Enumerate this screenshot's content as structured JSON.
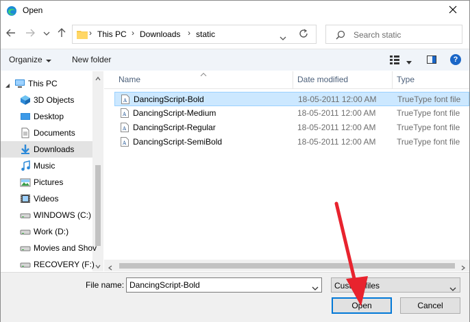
{
  "window": {
    "title": "Open",
    "icon": "edge-icon"
  },
  "nav": {
    "breadcrumbs": [
      "This PC",
      "Downloads",
      "static"
    ],
    "search_placeholder": "Search static"
  },
  "toolbar": {
    "organize_label": "Organize",
    "new_folder_label": "New folder",
    "help_label": "?"
  },
  "sidebar": {
    "items": [
      {
        "label": "This PC",
        "icon": "computer-icon"
      },
      {
        "label": "3D Objects",
        "icon": "3d-objects-icon"
      },
      {
        "label": "Desktop",
        "icon": "desktop-icon"
      },
      {
        "label": "Documents",
        "icon": "documents-icon"
      },
      {
        "label": "Downloads",
        "icon": "downloads-icon",
        "selected": true
      },
      {
        "label": "Music",
        "icon": "music-icon"
      },
      {
        "label": "Pictures",
        "icon": "pictures-icon"
      },
      {
        "label": "Videos",
        "icon": "videos-icon"
      },
      {
        "label": "WINDOWS (C:)",
        "icon": "drive-icon"
      },
      {
        "label": "Work (D:)",
        "icon": "drive-icon"
      },
      {
        "label": "Movies and Shov",
        "icon": "drive-icon"
      },
      {
        "label": "RECOVERY (F:)",
        "icon": "drive-icon"
      }
    ]
  },
  "files": {
    "columns": [
      "Name",
      "Date modified",
      "Type"
    ],
    "rows": [
      {
        "name": "DancingScript-Bold",
        "date": "18-05-2011 12:00 AM",
        "type": "TrueType font file",
        "selected": true
      },
      {
        "name": "DancingScript-Medium",
        "date": "18-05-2011 12:00 AM",
        "type": "TrueType font file"
      },
      {
        "name": "DancingScript-Regular",
        "date": "18-05-2011 12:00 AM",
        "type": "TrueType font file"
      },
      {
        "name": "DancingScript-SemiBold",
        "date": "18-05-2011 12:00 AM",
        "type": "TrueType font file"
      }
    ]
  },
  "bottom": {
    "file_name_label": "File name:",
    "file_name_value": "DancingScript-Bold",
    "file_type_value": "Custom files",
    "open_label": "Open",
    "cancel_label": "Cancel"
  },
  "colors": {
    "accent": "#0078d7",
    "selection": "#cce8ff",
    "annotation_arrow": "#e8232e"
  }
}
